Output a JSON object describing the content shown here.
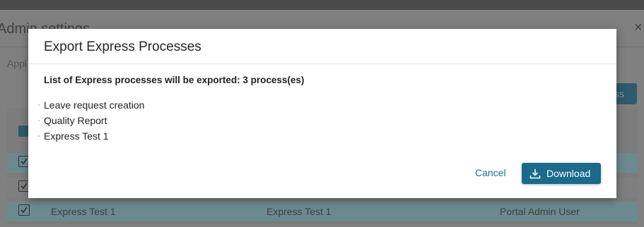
{
  "background": {
    "panel_title": "Admin settings",
    "close_glyph": "×",
    "tab_label": "Appl",
    "action_button_label": "ss",
    "rows": [
      {
        "col1": "",
        "col2": "",
        "col3": ""
      },
      {
        "col1": "",
        "col2": "",
        "col3": ""
      },
      {
        "col1": "Express Test 1",
        "col2": "Express Test 1",
        "col3": "Portal Admin User"
      }
    ]
  },
  "modal": {
    "title": "Export Express Processes",
    "summary": "List of Express processes will be exported: 3 process(es)",
    "processes": [
      "Leave request creation",
      "Quality Report",
      "Express Test 1"
    ],
    "cancel_label": "Cancel",
    "download_label": "Download",
    "download_icon": "download-icon"
  },
  "colors": {
    "primary": "#1a6a8c",
    "link": "#1f6f96"
  }
}
